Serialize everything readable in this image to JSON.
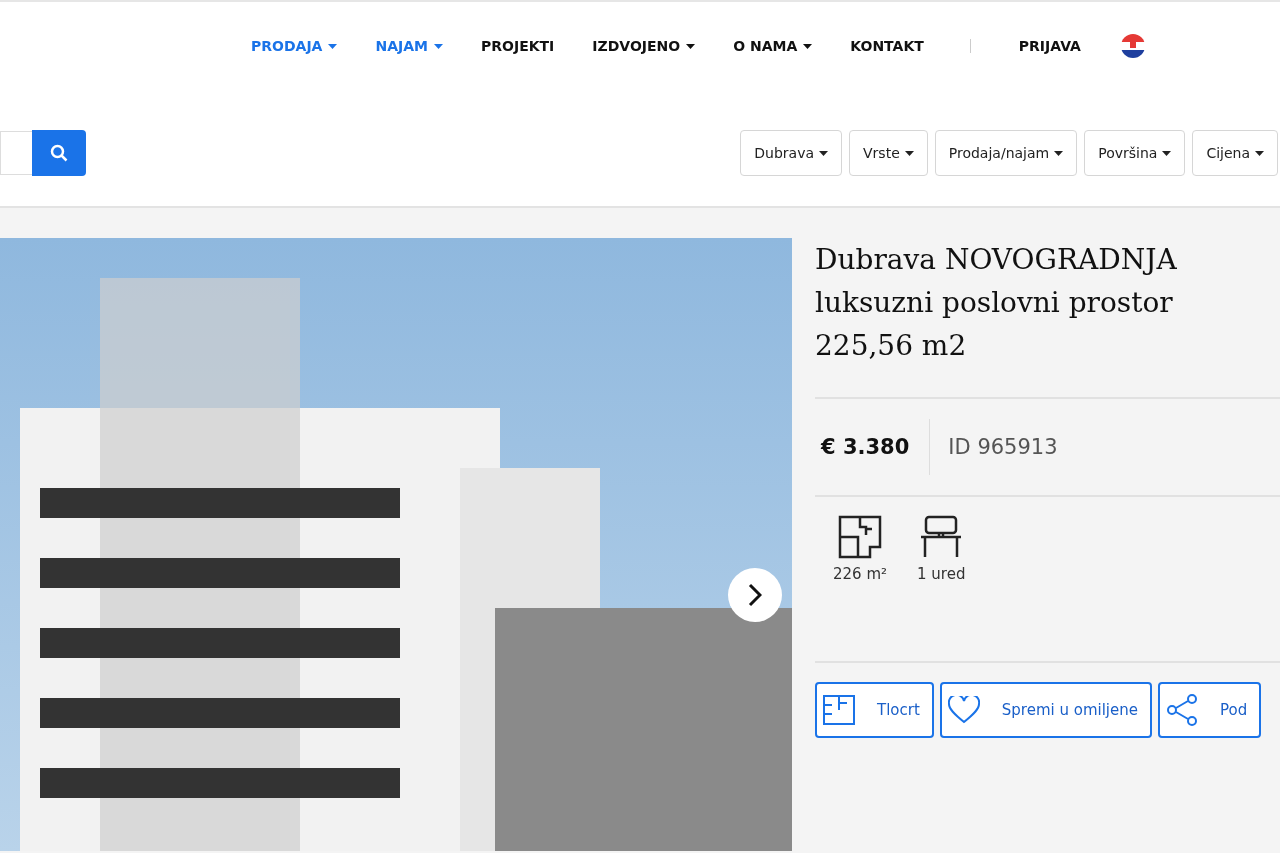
{
  "nav": {
    "items": [
      {
        "label": "PRODAJA",
        "dropdown": true,
        "selected": true
      },
      {
        "label": "NAJAM",
        "dropdown": true,
        "selected": true
      },
      {
        "label": "PROJEKTI",
        "dropdown": false,
        "selected": false
      },
      {
        "label": "IZDVOJENO",
        "dropdown": true,
        "selected": false
      },
      {
        "label": "O NAMA",
        "dropdown": true,
        "selected": false
      },
      {
        "label": "KONTAKT",
        "dropdown": false,
        "selected": false
      }
    ],
    "login": "PRIJAVA"
  },
  "filters": [
    "Dubrava",
    "Vrste",
    "Prodaja/najam",
    "Površina",
    "Cijena"
  ],
  "listing": {
    "title": "Dubrava NOVOGRADNJA luksuzni poslovni prostor 225,56 m2",
    "price": "€ 3.380",
    "id": "ID 965913",
    "features": [
      {
        "kind": "area",
        "label": "226 m²"
      },
      {
        "kind": "office",
        "label": "1 ured"
      }
    ],
    "actions": [
      {
        "kind": "plan",
        "label": "Tlocrt"
      },
      {
        "kind": "favorite",
        "label": "Spremi u omiljene"
      },
      {
        "kind": "share",
        "label": "Pod"
      }
    ]
  }
}
